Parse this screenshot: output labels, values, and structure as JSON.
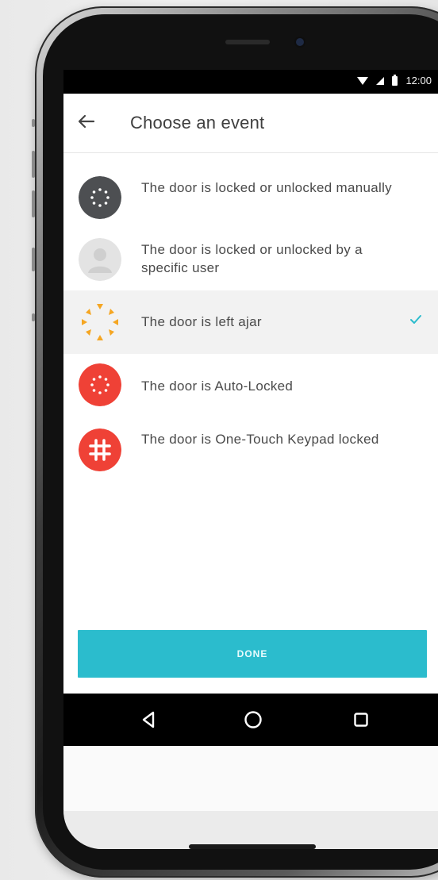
{
  "status_bar": {
    "time": "12:00",
    "icons": [
      "wifi-icon",
      "signal-icon",
      "battery-icon"
    ]
  },
  "toolbar": {
    "title": "Choose an event",
    "back_icon": "arrow-left-icon"
  },
  "events": [
    {
      "label": "The door is locked or unlocked manually",
      "icon": "manual-lock-icon",
      "icon_color": "#4d4f52",
      "selected": false
    },
    {
      "label": "The door is locked or unlocked by a specific user",
      "icon": "user-icon",
      "icon_color": "#e3e3e3",
      "selected": false
    },
    {
      "label": "The door is left ajar",
      "icon": "ajar-icon",
      "icon_color": "#f5a623",
      "selected": true
    },
    {
      "label": "The door is Auto-Locked",
      "icon": "auto-lock-icon",
      "icon_color": "#ef4136",
      "selected": false
    },
    {
      "label": "The door is One-Touch Keypad locked",
      "icon": "keypad-hash-icon",
      "icon_color": "#ef4136",
      "selected": false
    }
  ],
  "done_button": {
    "label": "DONE",
    "color": "#2bbccd"
  },
  "nav_bar": {
    "icons": [
      "back-triangle-icon",
      "home-circle-icon",
      "recents-square-icon"
    ]
  },
  "colors": {
    "accent": "#2bbccd",
    "check": "#2bbccd",
    "text": "#4a4a4a"
  }
}
